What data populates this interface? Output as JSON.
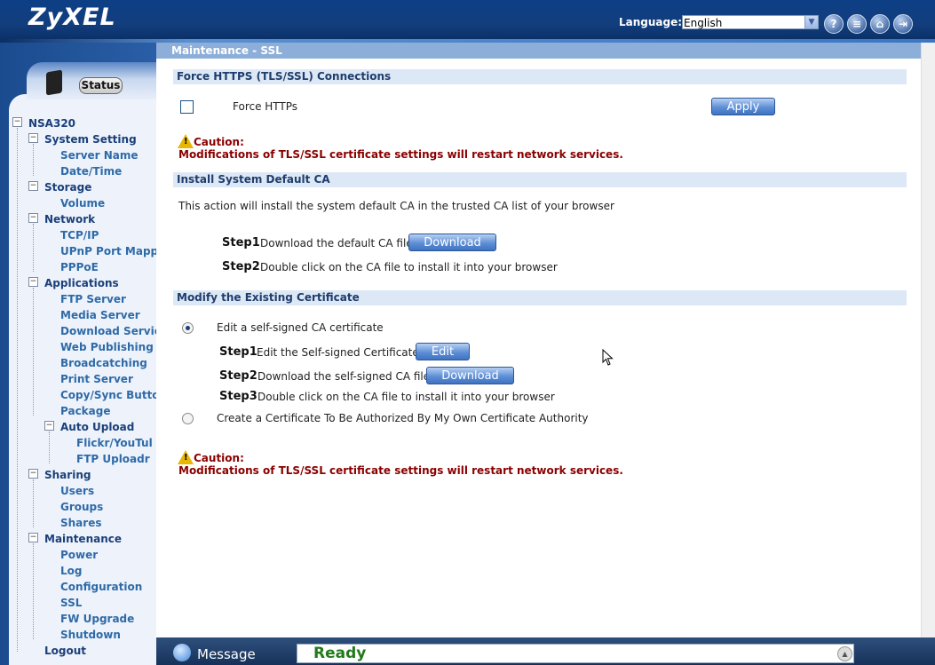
{
  "header": {
    "logo": "ZyXEL",
    "language_label": "Language:",
    "language_value": "English",
    "icons": [
      "help-icon",
      "notes-icon",
      "home-icon",
      "logout-icon"
    ]
  },
  "sidebar": {
    "status_label": "Status",
    "tree": {
      "root": "NSA320",
      "system_setting": "System Setting",
      "server_name": "Server Name",
      "date_time": "Date/Time",
      "storage": "Storage",
      "volume": "Volume",
      "network": "Network",
      "tcp_ip": "TCP/IP",
      "upnp": "UPnP Port Mappi",
      "pppoe": "PPPoE",
      "applications": "Applications",
      "ftp_server": "FTP Server",
      "media_server": "Media Server",
      "download_service": "Download Servic",
      "web_publishing": "Web Publishing",
      "broadcatching": "Broadcatching",
      "print_server": "Print Server",
      "copy_sync": "Copy/Sync Butto",
      "package": "Package",
      "auto_upload": "Auto Upload",
      "flickr": "Flickr/YouTul",
      "ftp_uploadr": "FTP Uploadr",
      "sharing": "Sharing",
      "users": "Users",
      "groups": "Groups",
      "shares": "Shares",
      "maintenance": "Maintenance",
      "power": "Power",
      "log": "Log",
      "configuration": "Configuration",
      "ssl": "SSL",
      "fw_upgrade": "FW Upgrade",
      "shutdown": "Shutdown",
      "logout": "Logout"
    }
  },
  "main": {
    "page_title": "Maintenance - SSL",
    "force_https": {
      "heading": "Force HTTPS (TLS/SSL) Connections",
      "checkbox_label": "Force HTTPs",
      "checked": false,
      "apply_label": "Apply"
    },
    "caution_title": "Caution:",
    "caution_msg": "Modifications of TLS/SSL certificate settings will restart network services.",
    "install_ca": {
      "heading": "Install System Default CA",
      "description": "This action will install the system default CA in the trusted CA list of your browser",
      "step1_label": "Step1",
      "step1_text": "Download the default CA file",
      "download_label": "Download",
      "step2_label": "Step2",
      "step2_text": "Double click on the CA file to install it into your browser"
    },
    "modify_cert": {
      "heading": "Modify the Existing Certificate",
      "option1": "Edit a self-signed CA certificate",
      "option1_selected": true,
      "step1_label": "Step1",
      "step1_text": "Edit the Self-signed Certificate",
      "edit_label": "Edit",
      "step2_label": "Step2",
      "step2_text": "Download the self-signed CA file",
      "download_label": "Download",
      "step3_label": "Step3",
      "step3_text": "Double click on the CA file to install it into your browser",
      "option2": "Create a Certificate To Be Authorized By My Own Certificate Authority",
      "option2_selected": false
    }
  },
  "footer": {
    "message_label": "Message",
    "status": "Ready"
  },
  "colors": {
    "header_bg": "#0d3f86",
    "section_bg": "#dde8f6",
    "caution": "#8a0000",
    "ready": "#217a1a"
  }
}
